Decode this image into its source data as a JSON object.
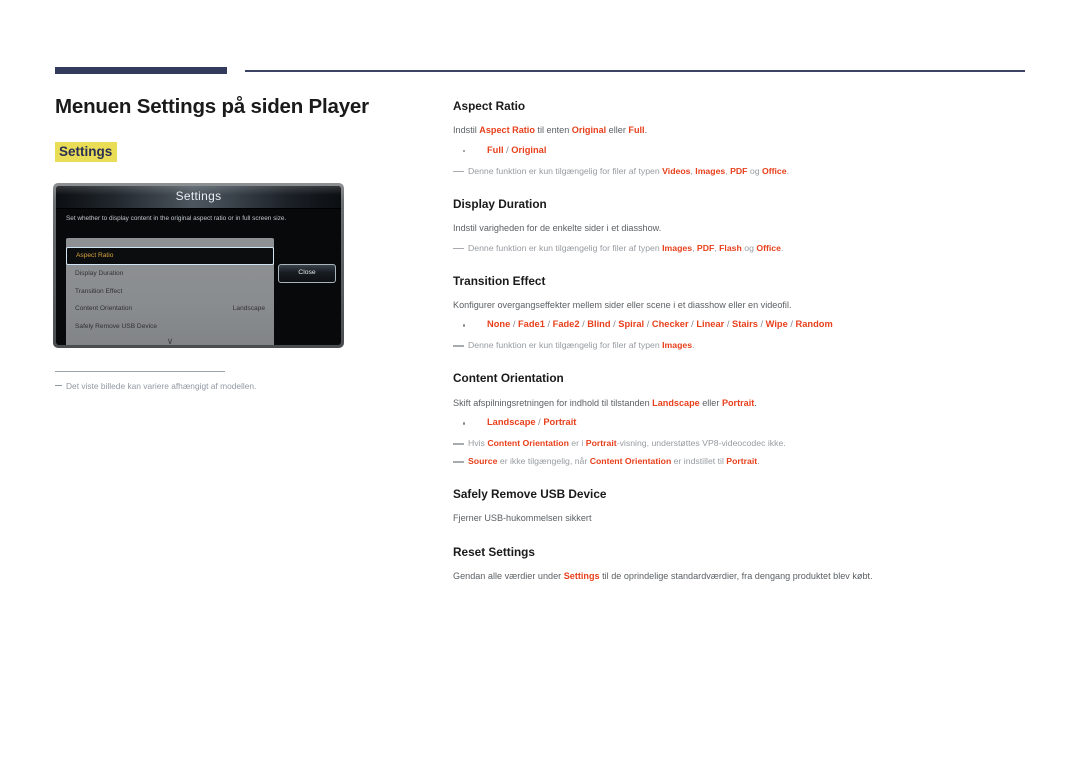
{
  "page": {
    "title": "Menuen Settings på siden Player",
    "tag_label": "Settings"
  },
  "device_mock": {
    "osd_title": "Settings",
    "osd_description": "Set whether to display content in the original aspect ratio or in full screen size.",
    "close_button": "Close",
    "scroll_arrow_icon": "chevron-down-icon",
    "rows": [
      {
        "label": "Aspect Ratio",
        "value": "",
        "selected": true
      },
      {
        "label": "Display Duration",
        "value": "",
        "selected": false
      },
      {
        "label": "Transition Effect",
        "value": "",
        "selected": false
      },
      {
        "label": "Content Orientation",
        "value": "Landscape",
        "selected": false
      },
      {
        "label": "Safely Remove USB Device",
        "value": "",
        "selected": false
      }
    ],
    "caption": "Det viste billede kan variere afhængigt af modellen."
  },
  "sections": {
    "aspect_ratio": {
      "heading": "Aspect Ratio",
      "desc_1": "Indstil ",
      "desc_term_1": "Aspect Ratio",
      "desc_2": " til enten ",
      "desc_term_2": "Original",
      "desc_3": " eller ",
      "desc_term_3": "Full",
      "desc_4": ".",
      "options": "Full / Original",
      "note_1": "Denne funktion er kun tilgængelig for filer af typen ",
      "note_1_t1": "Videos",
      "note_1_s1": ", ",
      "note_1_t2": "Images",
      "note_1_s2": ", ",
      "note_1_t3": "PDF",
      "note_1_s3": " og ",
      "note_1_t4": "Office",
      "note_1_end": "."
    },
    "display_duration": {
      "heading": "Display Duration",
      "desc": "Indstil varigheden for de enkelte sider i et diasshow.",
      "note_1": "Denne funktion er kun tilgængelig for filer af typen ",
      "note_1_t1": "Images",
      "note_1_s1": ", ",
      "note_1_t2": "PDF",
      "note_1_s2": ", ",
      "note_1_t3": "Flash",
      "note_1_s3": " og ",
      "note_1_t4": "Office",
      "note_1_end": "."
    },
    "transition_effect": {
      "heading": "Transition Effect",
      "desc": "Konfigurer overgangseffekter mellem sider eller scene i et diasshow eller en videofil.",
      "options": "None / Fade1 / Fade2 / Blind / Spiral / Checker / Linear / Stairs / Wipe / Random",
      "note_1": "Denne funktion er kun tilgængelig for filer af typen ",
      "note_1_t1": "Images",
      "note_1_end": "."
    },
    "content_orientation": {
      "heading": "Content Orientation",
      "desc_1": "Skift afspilningsretningen for indhold til tilstanden ",
      "desc_t1": "Landscape",
      "desc_2": " eller ",
      "desc_t2": "Portrait",
      "desc_3": ".",
      "options": "Landscape / Portrait",
      "note_1_a": "Hvis ",
      "note_1_t1": "Content Orientation",
      "note_1_b": " er i ",
      "note_1_t2": "Portrait",
      "note_1_c": "-visning, understøttes VP8-videocodec ikke.",
      "note_2_t1": "Source",
      "note_2_a": " er ikke tilgængelig, når ",
      "note_2_t2": "Content Orientation",
      "note_2_b": " er indstillet til ",
      "note_2_t3": "Portrait",
      "note_2_c": "."
    },
    "safely_remove": {
      "heading": "Safely Remove USB Device",
      "desc": "Fjerner USB-hukommelsen sikkert"
    },
    "reset_settings": {
      "heading": "Reset Settings",
      "desc_1": "Gendan alle værdier under ",
      "desc_t1": "Settings",
      "desc_2": " til de oprindelige standardværdier, fra dengang produktet blev købt."
    }
  },
  "colors": {
    "accent_red": "#e8401c",
    "navy_rule": "#323b5c",
    "highlight_yellow": "#e9dd57"
  }
}
